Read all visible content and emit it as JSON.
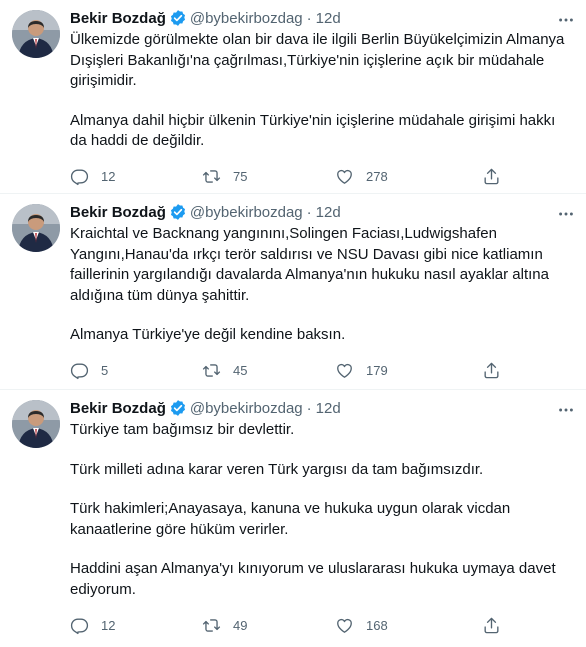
{
  "tweets": [
    {
      "name": "Bekir Bozdağ",
      "handle": "@bybekirbozdag",
      "dot": "·",
      "time": "12d",
      "paragraphs": [
        "Ülkemizde görülmekte olan bir dava ile ilgili Berlin Büyükelçimizin Almanya Dışişleri Bakanlığı'na çağrılması,Türkiye'nin içişlerine açık bir müdahale girişimidir.",
        "Almanya dahil hiçbir ülkenin Türkiye'nin içişlerine müdahale girişimi hakkı da haddi de değildir."
      ],
      "replies": "12",
      "retweets": "75",
      "likes": "278"
    },
    {
      "name": "Bekir Bozdağ",
      "handle": "@bybekirbozdag",
      "dot": "·",
      "time": "12d",
      "paragraphs": [
        "Kraichtal ve Backnang yangınını,Solingen Faciası,Ludwigshafen Yangını,Hanau'da ırkçı terör saldırısı ve NSU Davası gibi nice katliamın faillerinin yargılandığı davalarda Almanya'nın hukuku nasıl ayaklar altına aldığına tüm dünya şahittir.",
        "Almanya Türkiye'ye değil kendine baksın."
      ],
      "replies": "5",
      "retweets": "45",
      "likes": "179"
    },
    {
      "name": "Bekir Bozdağ",
      "handle": "@bybekirbozdag",
      "dot": "·",
      "time": "12d",
      "paragraphs": [
        "Türkiye tam bağımsız bir devlettir.",
        "Türk milleti adına karar veren Türk yargısı da tam bağımsızdır.",
        "Türk hakimleri;Anayasaya, kanuna ve hukuka uygun olarak vicdan kanaatlerine göre hüküm verirler.",
        "Haddini aşan Almanya'yı kınıyorum ve uluslararası hukuka uymaya davet ediyorum."
      ],
      "replies": "12",
      "retweets": "49",
      "likes": "168"
    }
  ],
  "icons": {
    "verified": "verified-badge-icon",
    "more": "more-icon",
    "reply": "reply-icon",
    "retweet": "retweet-icon",
    "like": "like-icon",
    "share": "share-icon"
  },
  "colors": {
    "verified": "#1d9bf0",
    "text": "#0f1419",
    "secondary": "#536471",
    "divider": "#eff3f4"
  }
}
